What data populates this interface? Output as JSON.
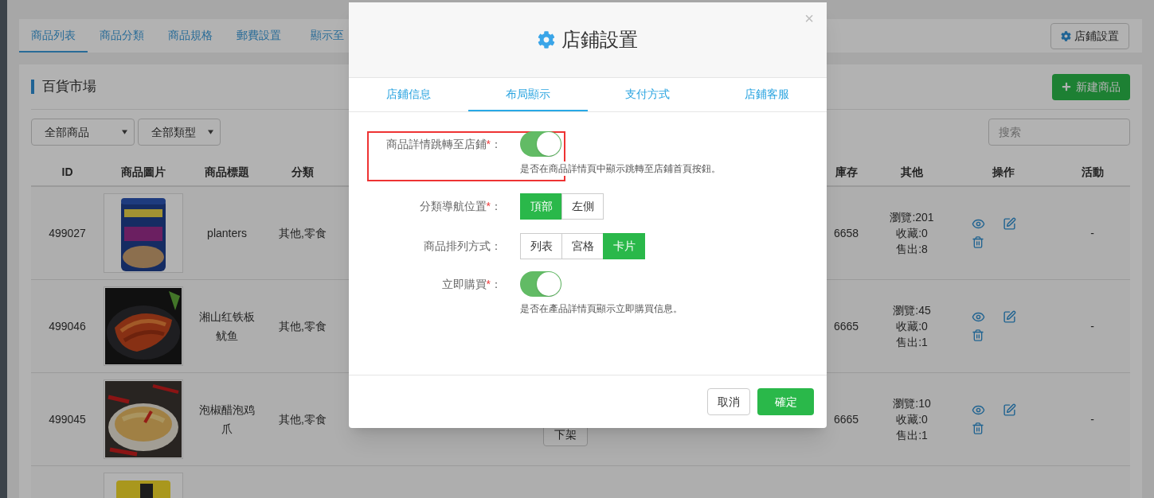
{
  "page_tabs": [
    {
      "label": "商品列表",
      "selected": true
    },
    {
      "label": "商品分類",
      "selected": false
    },
    {
      "label": "商品規格",
      "selected": false
    },
    {
      "label": "郵費設置",
      "selected": false
    },
    {
      "label": "顯示至",
      "selected": false
    }
  ],
  "shop_settings_button": "店鋪設置",
  "panel": {
    "title": "百貨市場",
    "new_button": "新建商品"
  },
  "filters": [
    {
      "value": "全部商品"
    },
    {
      "value": "全部類型"
    }
  ],
  "search": {
    "placeholder": "搜索"
  },
  "table": {
    "columns": [
      "ID",
      "商品圖片",
      "商品標題",
      "分類",
      "庫存",
      "其他",
      "操作",
      "活動"
    ],
    "rows": [
      {
        "id": "499027",
        "picture": {
          "kind": "picture"
        },
        "title": "planters",
        "category": "其他,零食",
        "stock": "6658",
        "stats": [
          "瀏覽:201",
          "收藏:0",
          "售出:8"
        ],
        "activity": "-"
      },
      {
        "id": "499046",
        "picture": {
          "kind": "picture"
        },
        "title": "湘山红铁板鱿鱼",
        "category": "其他,零食",
        "stock": "6665",
        "stats": [
          "瀏覽:45",
          "收藏:0",
          "售出:1"
        ],
        "activity": "-"
      },
      {
        "id": "499045",
        "picture": {
          "kind": "picture"
        },
        "title": "泡椒醋泡鸡爪",
        "category": "其他,零食",
        "status_button": "下架",
        "stock": "6665",
        "stats": [
          "瀏覽:10",
          "收藏:0",
          "售出:1"
        ],
        "activity": "-"
      },
      {
        "picture": {
          "kind": "picture"
        }
      }
    ]
  },
  "modal": {
    "title": "店鋪設置",
    "close": "×",
    "tabs": [
      {
        "label": "店鋪信息",
        "selected": false
      },
      {
        "label": "布局顯示",
        "selected": true
      },
      {
        "label": "支付方式",
        "selected": false
      },
      {
        "label": "店鋪客服",
        "selected": false
      }
    ],
    "fields": [
      {
        "kind": "toggle",
        "label": "商品詳情跳轉至店鋪",
        "required_mark": "*",
        "colon": "：",
        "on": true,
        "highlighted": true,
        "hint": "是否在商品詳情頁中顯示跳轉至店鋪首頁按鈕。"
      },
      {
        "kind": "segmented",
        "label": "分類導航位置",
        "required_mark": "*",
        "colon": "：",
        "highlighted": false,
        "options": [
          {
            "label": "頂部",
            "selected": true
          },
          {
            "label": "左側",
            "selected": false
          }
        ]
      },
      {
        "kind": "segmented",
        "label": "商品排列方式",
        "colon": "：",
        "highlighted": false,
        "options": [
          {
            "label": "列表",
            "selected": false
          },
          {
            "label": "宮格",
            "selected": false
          },
          {
            "label": "卡片",
            "selected": true
          }
        ]
      },
      {
        "kind": "toggle",
        "label": "立即購買",
        "required_mark": "*",
        "colon": "：",
        "on": true,
        "highlighted": false,
        "hint": "是否在產品詳情頁顯示立即購買信息。"
      }
    ],
    "buttons": [
      {
        "label": "取消",
        "kind": "secondary"
      },
      {
        "label": "確定",
        "kind": "primary"
      }
    ]
  }
}
